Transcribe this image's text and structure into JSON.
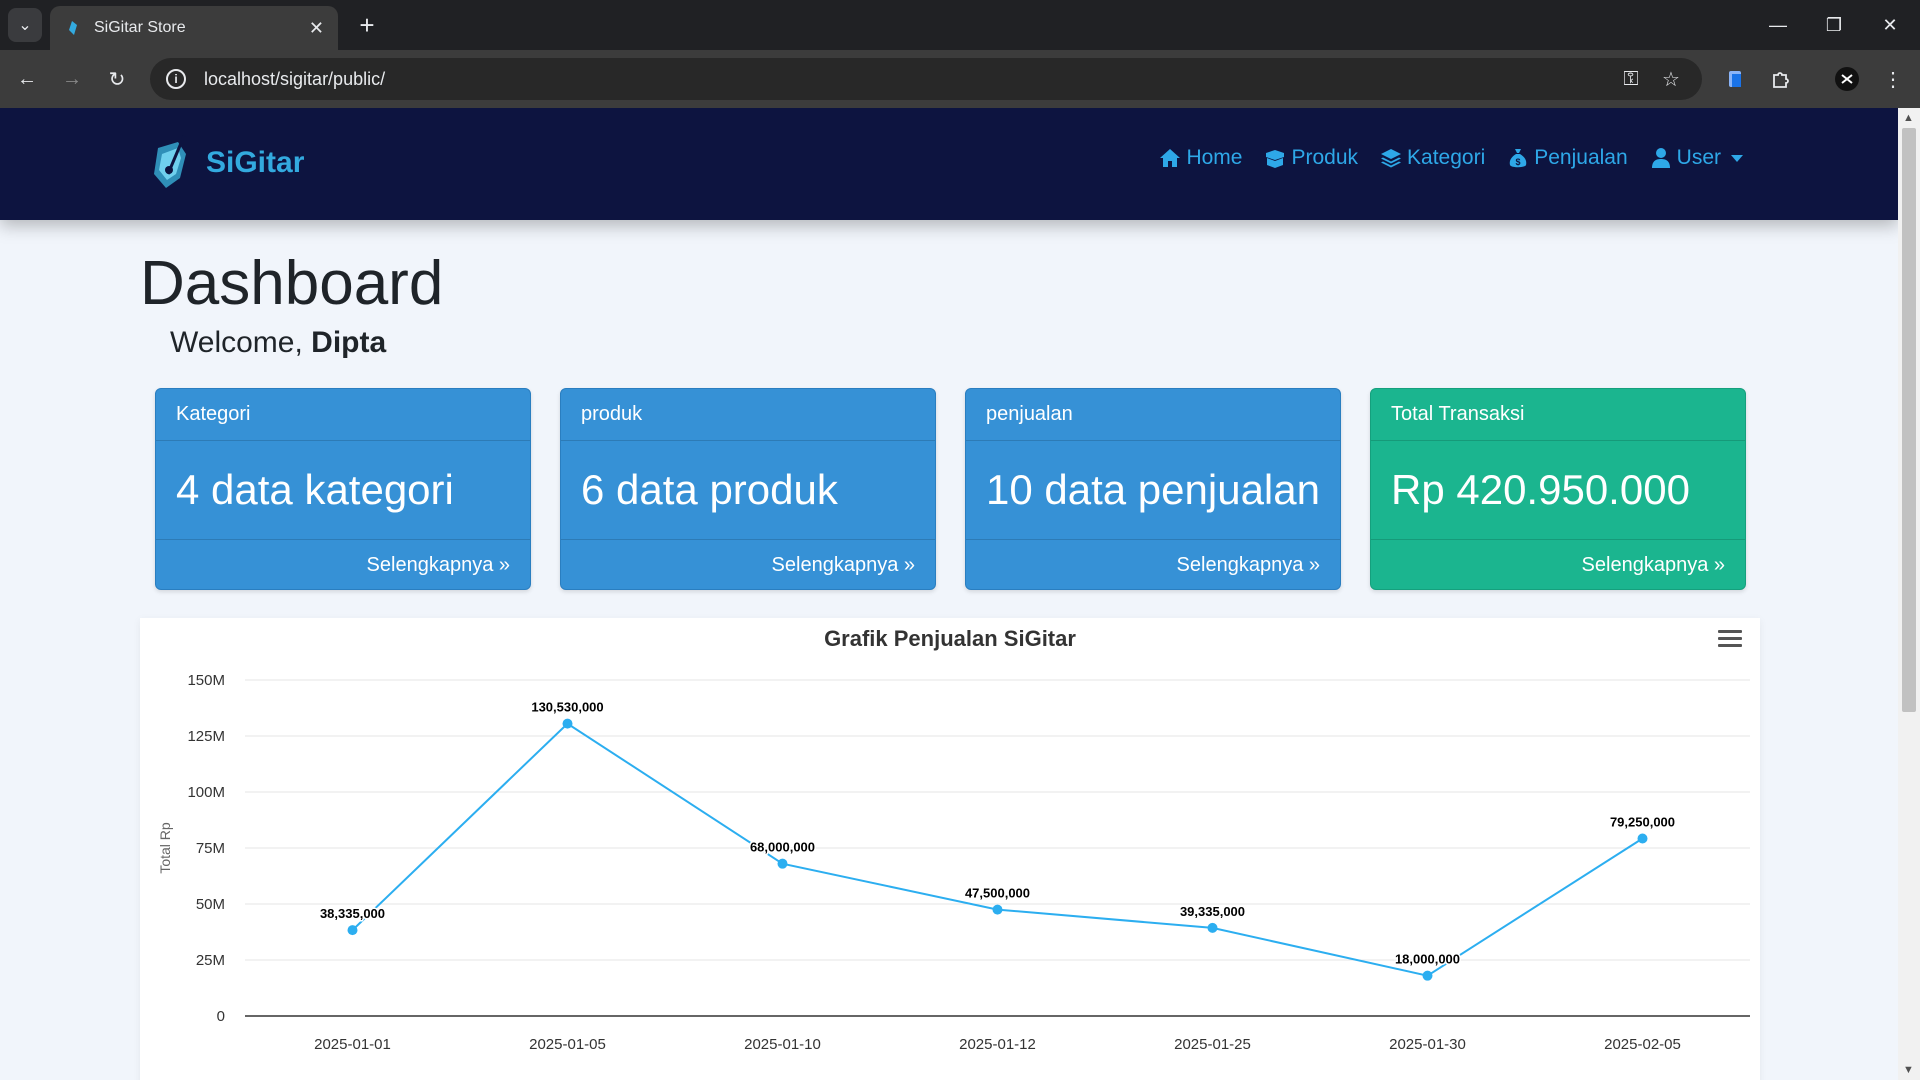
{
  "browser": {
    "tab_title": "SiGitar Store",
    "url": "localhost/sigitar/public/"
  },
  "navbar": {
    "brand": "SiGitar",
    "items": [
      {
        "label": "Home",
        "icon": "home-icon"
      },
      {
        "label": "Produk",
        "icon": "box-icon"
      },
      {
        "label": "Kategori",
        "icon": "layers-icon"
      },
      {
        "label": "Penjualan",
        "icon": "money-bag-icon"
      },
      {
        "label": "User",
        "icon": "user-icon"
      }
    ]
  },
  "page": {
    "title": "Dashboard",
    "welcome_prefix": "Welcome,",
    "welcome_name": "Dipta"
  },
  "cards": [
    {
      "header": "Kategori",
      "value": "4 data kategori",
      "link": "Selengkapnya »",
      "color": "#3691d6"
    },
    {
      "header": "produk",
      "value": "6 data produk",
      "link": "Selengkapnya »",
      "color": "#3691d6"
    },
    {
      "header": "penjualan",
      "value": "10 data penjualan",
      "link": "Selengkapnya »",
      "color": "#3691d6"
    },
    {
      "header": "Total Transaksi",
      "value": "Rp 420.950.000",
      "link": "Selengkapnya »",
      "color": "#1bb58f"
    }
  ],
  "chart_data": {
    "type": "line",
    "title": "Grafik Penjualan SiGitar",
    "ylabel": "Total Rp",
    "categories": [
      "2025-01-01",
      "2025-01-05",
      "2025-01-10",
      "2025-01-12",
      "2025-01-25",
      "2025-01-30",
      "2025-02-05"
    ],
    "series": [
      {
        "values": [
          38335000,
          130530000,
          68000000,
          47500000,
          39335000,
          18000000,
          79250000
        ]
      }
    ],
    "data_labels": [
      "38,335,000",
      "130,530,000",
      "68,000,000",
      "47,500,000",
      "39,335,000",
      "18,000,000",
      "79,250,000"
    ],
    "ylim": [
      0,
      150000000
    ],
    "yticks": [
      0,
      25000000,
      50000000,
      75000000,
      100000000,
      125000000,
      150000000
    ],
    "ytick_labels": [
      "0",
      "25M",
      "50M",
      "75M",
      "100M",
      "125M",
      "150M"
    ],
    "grid": true,
    "line_color": "#2caef0"
  }
}
